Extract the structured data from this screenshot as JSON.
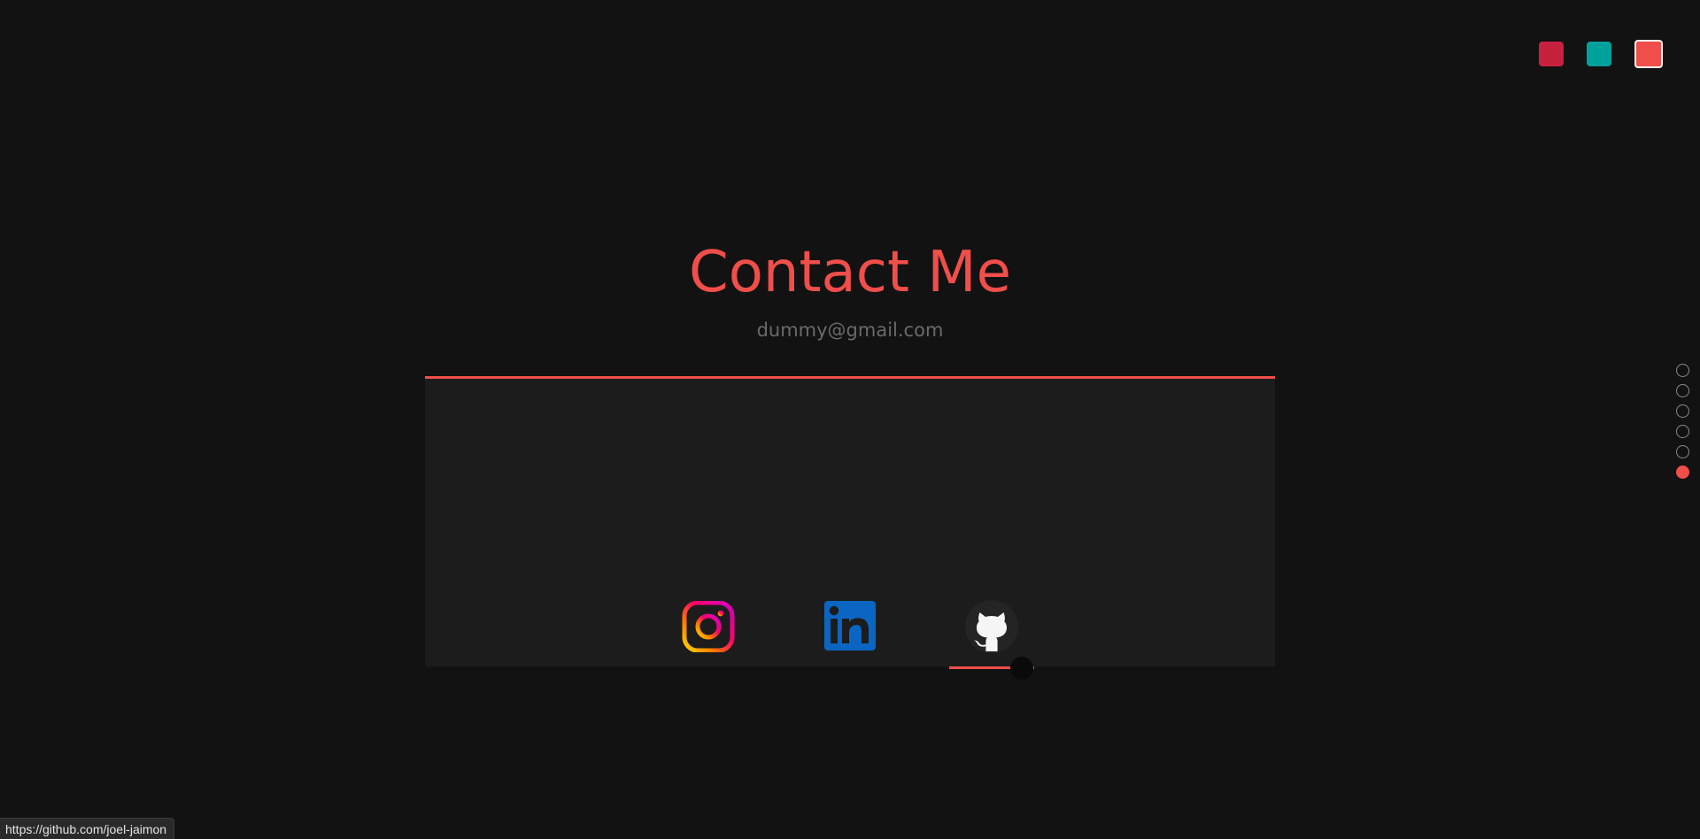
{
  "theme": {
    "accent": "#f04e4a",
    "swatches": [
      {
        "name": "crimson",
        "color": "#c8203f",
        "selected": false
      },
      {
        "name": "teal",
        "color": "#00a19a",
        "selected": false
      },
      {
        "name": "coral",
        "color": "#f04e4a",
        "selected": true
      }
    ]
  },
  "contact": {
    "title": "Contact Me",
    "email": "dummy@gmail.com"
  },
  "social": {
    "links": [
      {
        "name": "instagram",
        "icon": "instagram-icon"
      },
      {
        "name": "linkedin",
        "icon": "linkedin-icon"
      },
      {
        "name": "github",
        "icon": "github-icon",
        "active": true
      }
    ]
  },
  "section_nav": {
    "count": 6,
    "active_index": 5
  },
  "status_bar": {
    "url": "https://github.com/joel-jaimon"
  }
}
